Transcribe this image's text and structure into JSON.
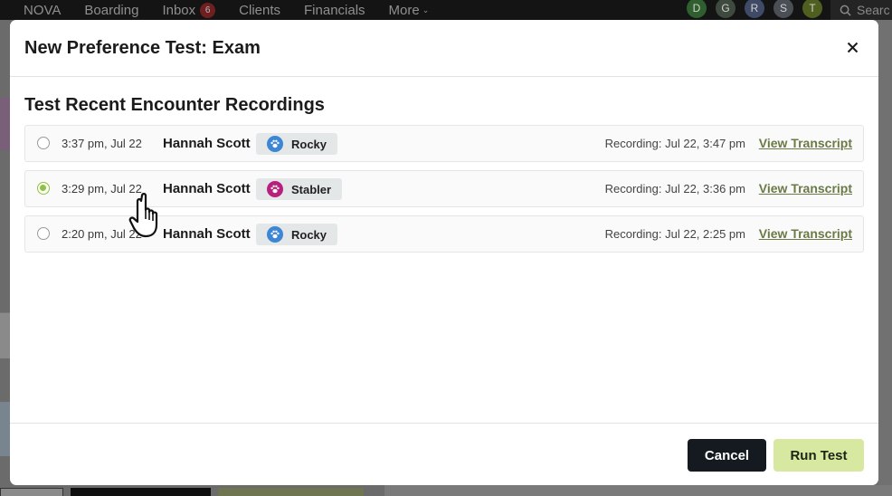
{
  "topnav": {
    "items": [
      {
        "label": "NOVA"
      },
      {
        "label": "Boarding"
      },
      {
        "label": "Inbox",
        "badge": "6"
      },
      {
        "label": "Clients"
      },
      {
        "label": "Financials"
      },
      {
        "label": "More"
      }
    ],
    "avatars": [
      {
        "initial": "D",
        "color": "#2f5f2f"
      },
      {
        "initial": "G",
        "color": "#3f4a3f"
      },
      {
        "initial": "R",
        "color": "#3f4a66"
      },
      {
        "initial": "S",
        "color": "#4a4f55"
      },
      {
        "initial": "T",
        "color": "#4f5f1f"
      }
    ],
    "search_placeholder": "Searc"
  },
  "modal": {
    "title": "New Preference Test: Exam",
    "section_title": "Test Recent Encounter Recordings",
    "recordings": [
      {
        "time": "3:37 pm, Jul 22",
        "client": "Hannah Scott",
        "pet": "Rocky",
        "pet_icon": "paw-icon",
        "pet_icon_color": "#3d86d6",
        "recording": "Recording: Jul 22, 3:47 pm",
        "link": "View Transcript",
        "selected": false
      },
      {
        "time": "3:29 pm, Jul 22",
        "client": "Hannah Scott",
        "pet": "Stabler",
        "pet_icon": "paw-icon",
        "pet_icon_color": "#b7217d",
        "recording": "Recording: Jul 22, 3:36 pm",
        "link": "View Transcript",
        "selected": true
      },
      {
        "time": "2:20 pm, Jul 22",
        "client": "Hannah Scott",
        "pet": "Rocky",
        "pet_icon": "paw-icon",
        "pet_icon_color": "#3d86d6",
        "recording": "Recording: Jul 22, 2:25 pm",
        "link": "View Transcript",
        "selected": false
      }
    ],
    "cancel_label": "Cancel",
    "run_label": "Run Test"
  },
  "colors": {
    "accent_green": "#8fc23e",
    "link_olive": "#6a7a45",
    "primary_dark": "#141a1f",
    "run_button": "#d7e9a1"
  }
}
